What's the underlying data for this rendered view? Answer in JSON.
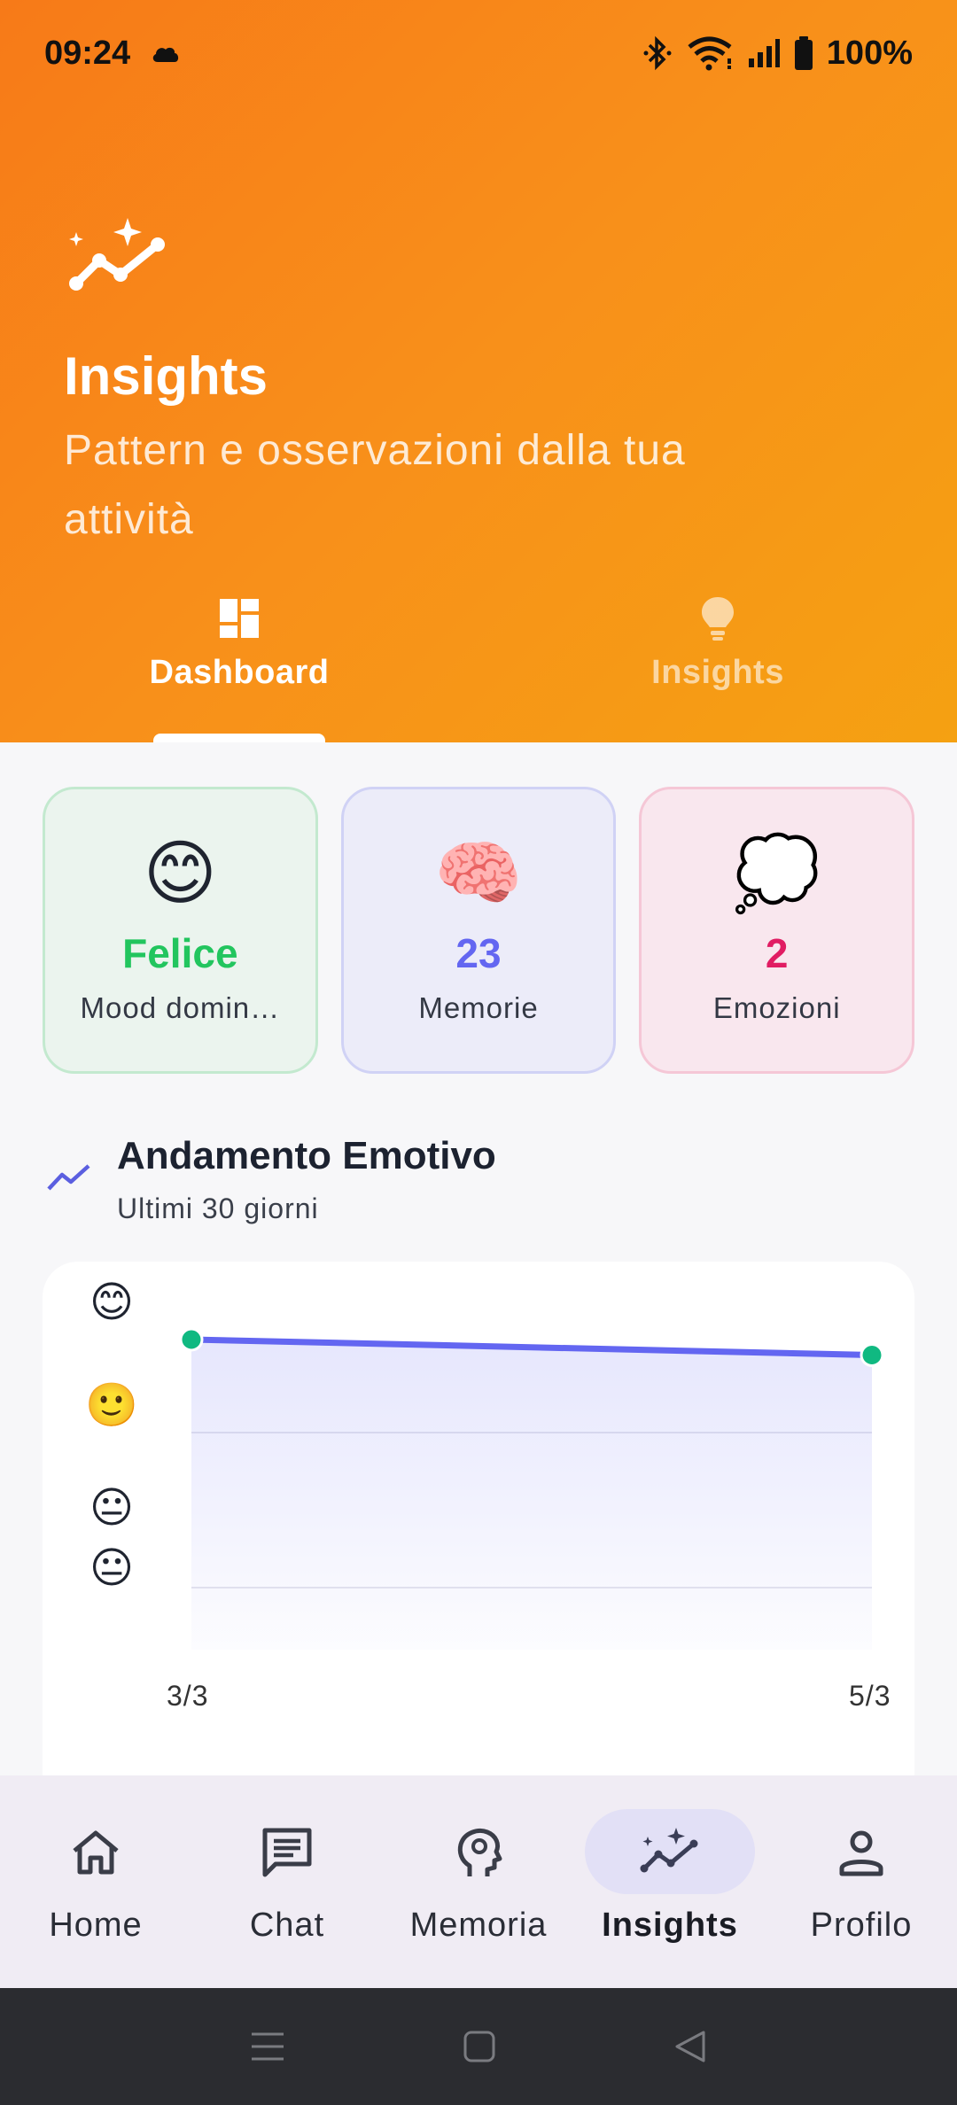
{
  "status_bar": {
    "time": "09:24",
    "battery": "100%"
  },
  "header": {
    "title": "Insights",
    "subtitle": "Pattern e osservazioni dalla tua attività",
    "icon": "insights-sparkle-icon"
  },
  "tabs": [
    {
      "label": "Dashboard",
      "icon": "dashboard-icon",
      "active": true
    },
    {
      "label": "Insights",
      "icon": "lightbulb-icon",
      "active": false
    }
  ],
  "stats": [
    {
      "emoji": "😊",
      "value": "Felice",
      "label": "Mood domin…",
      "color": "#22c55e"
    },
    {
      "emoji": "🧠",
      "value": "23",
      "label": "Memorie",
      "color": "#6366f1"
    },
    {
      "emoji": "💭",
      "value": "2",
      "label": "Emozioni",
      "color": "#e11d63"
    }
  ],
  "section": {
    "title": "Andamento Emotivo",
    "subtitle": "Ultimi 30 giorni",
    "icon": "trending-up-icon"
  },
  "chart_data": {
    "type": "area",
    "title": "Andamento Emotivo",
    "x": [
      "3/3",
      "5/3"
    ],
    "series": [
      {
        "values": [
          3.6,
          3.5
        ],
        "color": "#6366f1"
      }
    ],
    "y_tick_labels": [
      "😊",
      "🙂",
      "😐",
      "😐"
    ],
    "ylim": [
      1.6,
      4
    ],
    "grid": true
  },
  "bottom_nav": [
    {
      "label": "Home",
      "icon": "home-icon",
      "active": false
    },
    {
      "label": "Chat",
      "icon": "chat-icon",
      "active": false
    },
    {
      "label": "Memoria",
      "icon": "brain-head-icon",
      "active": false
    },
    {
      "label": "Insights",
      "icon": "insights-sparkle-icon",
      "active": true
    },
    {
      "label": "Profilo",
      "icon": "person-icon",
      "active": false
    }
  ]
}
